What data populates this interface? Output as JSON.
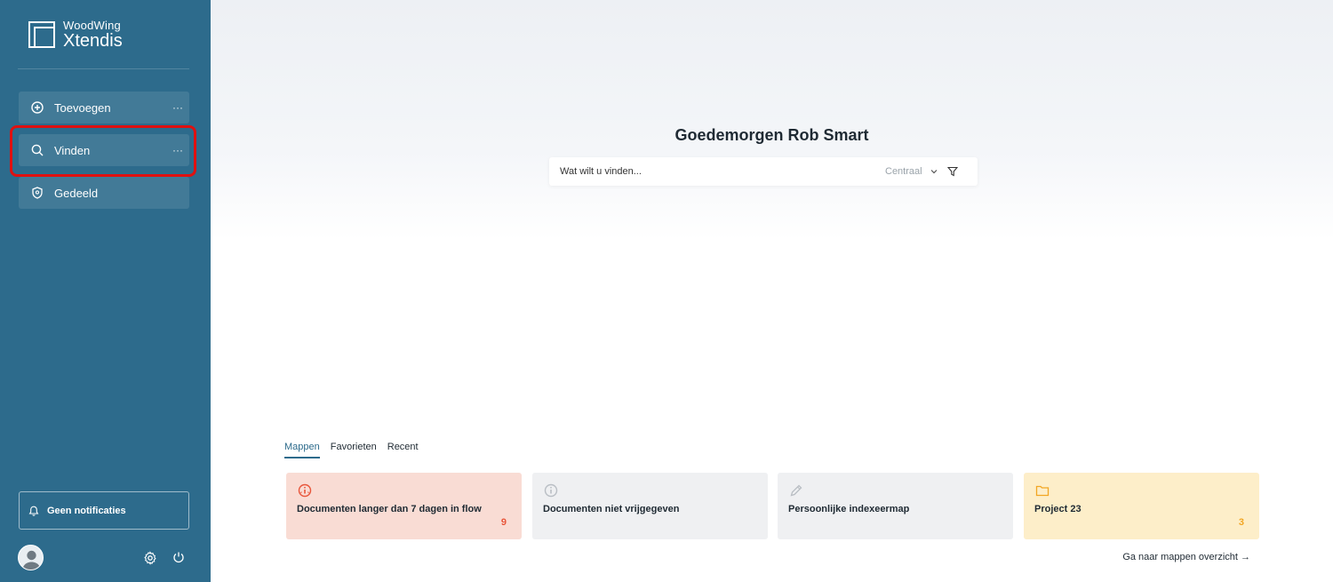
{
  "app": {
    "brand_small": "WoodWing",
    "brand_large": "Xtendis"
  },
  "sidebar": {
    "items": [
      {
        "label": "Toevoegen",
        "icon": "plus-circle-icon",
        "more": "···"
      },
      {
        "label": "Vinden",
        "icon": "search-icon",
        "more": "···"
      },
      {
        "label": "Gedeeld",
        "icon": "shield-icon"
      }
    ],
    "notifications_label": "Geen notificaties"
  },
  "main": {
    "greeting": "Goedemorgen Rob Smart",
    "search": {
      "placeholder": "Wat wilt u vinden...",
      "scope": "Centraal"
    },
    "tabs": [
      "Mappen",
      "Favorieten",
      "Recent"
    ],
    "active_tab": "Mappen",
    "cards": [
      {
        "title": "Documenten langer dan 7 dagen in flow",
        "count": "9",
        "icon": "alert-info-icon",
        "color": "#f9dcd4",
        "accent": "#e8553a"
      },
      {
        "title": "Documenten niet vrijgegeven",
        "count": "",
        "icon": "info-icon",
        "color": "#eff0f2",
        "accent": "#b9bec4"
      },
      {
        "title": "Persoonlijke indexeermap",
        "count": "",
        "icon": "pencil-icon",
        "color": "#eff0f2",
        "accent": "#b9bec4"
      },
      {
        "title": "Project 23",
        "count": "3",
        "icon": "folder-icon",
        "color": "#fdeec9",
        "accent": "#f2a623"
      }
    ],
    "overview_link": "Ga naar mappen overzicht →"
  },
  "colors": {
    "sidebar": "#2d6b8c",
    "highlight": "#e01010"
  }
}
